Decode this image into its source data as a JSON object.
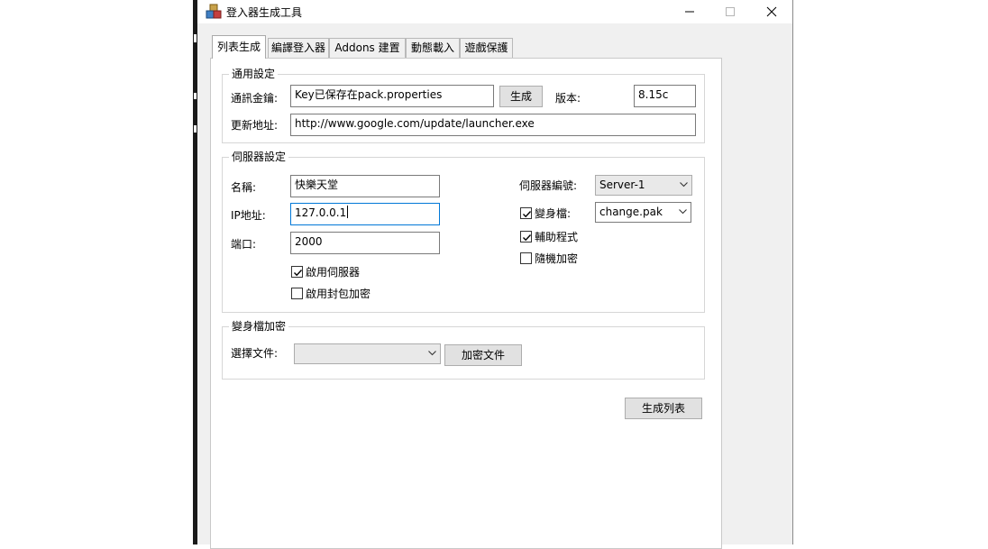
{
  "window": {
    "title": "登入器生成工具",
    "icon": "app-cube-icon"
  },
  "tabs": [
    {
      "label": "列表生成",
      "active": true
    },
    {
      "label": "編譯登入器",
      "active": false
    },
    {
      "label": "Addons 建置",
      "active": false
    },
    {
      "label": "動態載入",
      "active": false
    },
    {
      "label": "遊戲保護",
      "active": false
    }
  ],
  "general": {
    "group_title": "通用設定",
    "key_label": "通訊金鑰:",
    "key_value": "Key已保存在pack.properties",
    "generate_button": "生成",
    "version_label": "版本:",
    "version_value": "8.15c",
    "update_label": "更新地址:",
    "update_value": "http://www.google.com/update/launcher.exe"
  },
  "server": {
    "group_title": "伺服器設定",
    "name_label": "名稱:",
    "name_value": "快樂天堂",
    "ip_label": "IP地址:",
    "ip_value": "127.0.0.1",
    "port_label": "端口:",
    "port_value": "2000",
    "enable_server_label": "啟用伺服器",
    "enable_server_checked": true,
    "enable_packet_enc_label": "啟用封包加密",
    "enable_packet_enc_checked": false,
    "server_number_label": "伺服器編號:",
    "server_number_value": "Server-1",
    "morph_label": "變身檔:",
    "morph_checked": true,
    "morph_value": "change.pak",
    "helper_label": "輔助程式",
    "helper_checked": true,
    "random_enc_label": "隨機加密",
    "random_enc_checked": false
  },
  "morph_encrypt": {
    "group_title": "變身檔加密",
    "select_file_label": "選擇文件:",
    "select_file_value": "",
    "encrypt_button": "加密文件"
  },
  "generate_list_button": "生成列表"
}
